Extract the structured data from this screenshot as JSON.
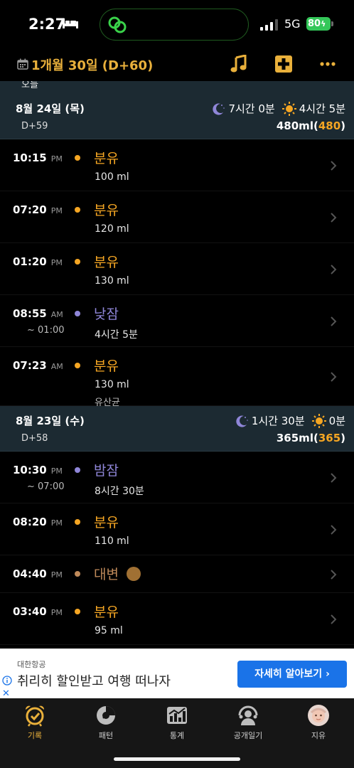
{
  "status_bar": {
    "time": "2:27",
    "network": "5G",
    "battery": "80"
  },
  "header": {
    "title": "1개월 30일 (D+60)",
    "icons": [
      "calendar-icon",
      "music-note-icon",
      "medical-plus-icon",
      "more-icon"
    ]
  },
  "today_label": "오늘",
  "days": [
    {
      "date": "8월 24일 (목)",
      "dcount": "D+59",
      "sleep_summary": "7시간 0분",
      "wake_summary": "4시간 5분",
      "total_ml": "480ml",
      "total_paren": "480",
      "entries": [
        {
          "time": "10:15",
          "ampm": "PM",
          "title": "분유",
          "amount": "100 ml",
          "color": "#f5a623"
        },
        {
          "time": "07:20",
          "ampm": "PM",
          "title": "분유",
          "amount": "120 ml",
          "color": "#f5a623"
        },
        {
          "time": "01:20",
          "ampm": "PM",
          "title": "분유",
          "amount": "130 ml",
          "color": "#f5a623"
        },
        {
          "time": "08:55",
          "ampm": "AM",
          "end": "~ 01:00",
          "title": "낮잠",
          "amount": "4시간 5분",
          "color": "#8f86d8"
        },
        {
          "time": "07:23",
          "ampm": "AM",
          "title": "분유",
          "amount": "130 ml",
          "note": "유산균",
          "color": "#f5a623"
        }
      ]
    },
    {
      "date": "8월 23일 (수)",
      "dcount": "D+58",
      "sleep_summary": "1시간 30분",
      "wake_summary": "0분",
      "total_ml": "365ml",
      "total_paren": "365",
      "entries": [
        {
          "time": "10:30",
          "ampm": "PM",
          "end": "~ 07:00",
          "title": "밤잠",
          "amount": "8시간 30분",
          "color": "#8f86d8"
        },
        {
          "time": "08:20",
          "ampm": "PM",
          "title": "분유",
          "amount": "110 ml",
          "color": "#f5a623"
        },
        {
          "time": "04:40",
          "ampm": "PM",
          "title": "대변",
          "color": "#c08a5a"
        },
        {
          "time": "03:40",
          "ampm": "PM",
          "title": "분유",
          "amount": "95 ml",
          "color": "#f5a623"
        }
      ]
    }
  ],
  "ad": {
    "brand": "대한항공",
    "text": "취리히 할인받고 여행 떠나자",
    "button": "자세히 알아보기",
    "close": "✕"
  },
  "tabs": [
    {
      "label": "기록",
      "icon": "alarm-clock-icon",
      "active": true
    },
    {
      "label": "패턴",
      "icon": "pattern-chart-icon"
    },
    {
      "label": "통계",
      "icon": "statistics-icon"
    },
    {
      "label": "공개일기",
      "icon": "public-diary-icon"
    },
    {
      "label": "지유",
      "icon": "baby-avatar-icon"
    }
  ],
  "colors": {
    "accent": "#e9b03b",
    "feeding": "#f5a623",
    "sleep": "#8f86d8",
    "poop": "#a07033",
    "day_header_bg": "#1c2a32"
  }
}
